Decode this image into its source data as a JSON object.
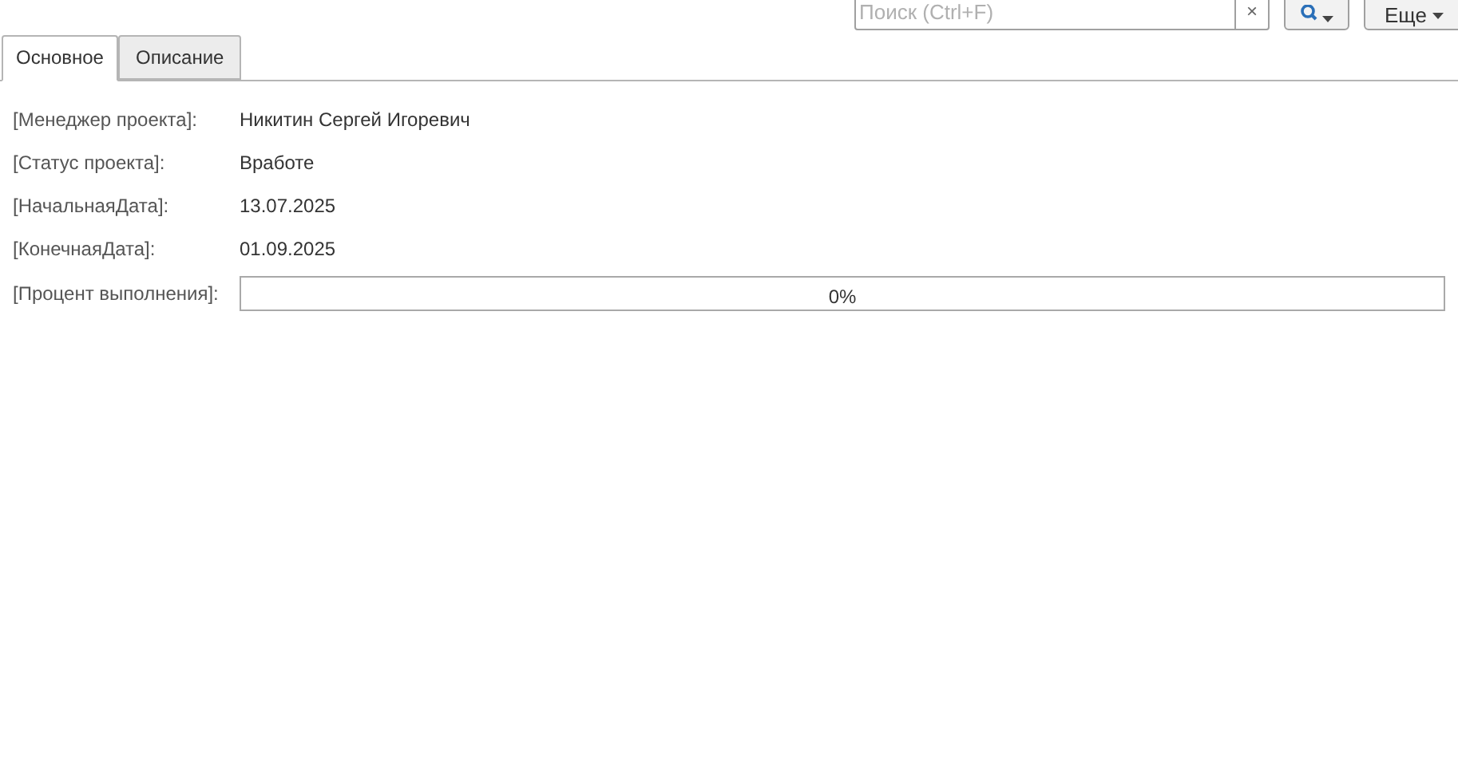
{
  "toolbar": {
    "search": {
      "placeholder": "Поиск (Ctrl+F)",
      "clear": "×"
    },
    "more_button": "Еще"
  },
  "tabs": [
    {
      "label": "Основное",
      "selected": true
    },
    {
      "label": "Описание",
      "selected": false
    }
  ],
  "fields": [
    {
      "kind": "text",
      "label": "[Менеджер проекта]:",
      "value": "Никитин Сергей Игоревич"
    },
    {
      "kind": "text",
      "label": "[Статус проекта]:",
      "value": "Вработе"
    },
    {
      "kind": "text",
      "label": "[НачальнаяДата]:",
      "value": "13.07.2025"
    },
    {
      "kind": "text",
      "label": "[КонечнаяДата]:",
      "value": "01.09.2025"
    },
    {
      "kind": "progress",
      "label": "[Процент выполнения]:",
      "value": "0%",
      "level": 0
    }
  ]
}
